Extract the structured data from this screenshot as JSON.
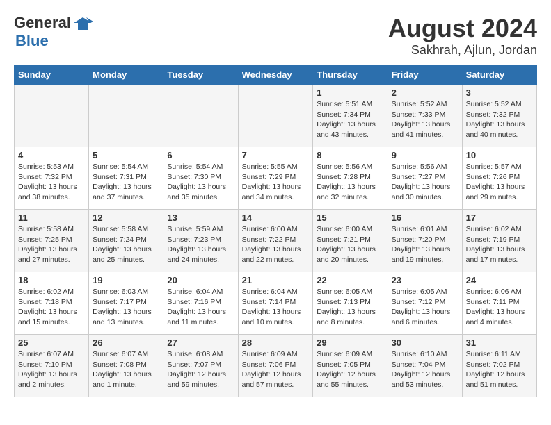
{
  "header": {
    "logo_general": "General",
    "logo_blue": "Blue",
    "title": "August 2024",
    "subtitle": "Sakhrah, Ajlun, Jordan"
  },
  "days_of_week": [
    "Sunday",
    "Monday",
    "Tuesday",
    "Wednesday",
    "Thursday",
    "Friday",
    "Saturday"
  ],
  "weeks": [
    {
      "cells": [
        {
          "day": "",
          "info": ""
        },
        {
          "day": "",
          "info": ""
        },
        {
          "day": "",
          "info": ""
        },
        {
          "day": "",
          "info": ""
        },
        {
          "day": "1",
          "info": "Sunrise: 5:51 AM\nSunset: 7:34 PM\nDaylight: 13 hours\nand 43 minutes."
        },
        {
          "day": "2",
          "info": "Sunrise: 5:52 AM\nSunset: 7:33 PM\nDaylight: 13 hours\nand 41 minutes."
        },
        {
          "day": "3",
          "info": "Sunrise: 5:52 AM\nSunset: 7:32 PM\nDaylight: 13 hours\nand 40 minutes."
        }
      ]
    },
    {
      "cells": [
        {
          "day": "4",
          "info": "Sunrise: 5:53 AM\nSunset: 7:32 PM\nDaylight: 13 hours\nand 38 minutes."
        },
        {
          "day": "5",
          "info": "Sunrise: 5:54 AM\nSunset: 7:31 PM\nDaylight: 13 hours\nand 37 minutes."
        },
        {
          "day": "6",
          "info": "Sunrise: 5:54 AM\nSunset: 7:30 PM\nDaylight: 13 hours\nand 35 minutes."
        },
        {
          "day": "7",
          "info": "Sunrise: 5:55 AM\nSunset: 7:29 PM\nDaylight: 13 hours\nand 34 minutes."
        },
        {
          "day": "8",
          "info": "Sunrise: 5:56 AM\nSunset: 7:28 PM\nDaylight: 13 hours\nand 32 minutes."
        },
        {
          "day": "9",
          "info": "Sunrise: 5:56 AM\nSunset: 7:27 PM\nDaylight: 13 hours\nand 30 minutes."
        },
        {
          "day": "10",
          "info": "Sunrise: 5:57 AM\nSunset: 7:26 PM\nDaylight: 13 hours\nand 29 minutes."
        }
      ]
    },
    {
      "cells": [
        {
          "day": "11",
          "info": "Sunrise: 5:58 AM\nSunset: 7:25 PM\nDaylight: 13 hours\nand 27 minutes."
        },
        {
          "day": "12",
          "info": "Sunrise: 5:58 AM\nSunset: 7:24 PM\nDaylight: 13 hours\nand 25 minutes."
        },
        {
          "day": "13",
          "info": "Sunrise: 5:59 AM\nSunset: 7:23 PM\nDaylight: 13 hours\nand 24 minutes."
        },
        {
          "day": "14",
          "info": "Sunrise: 6:00 AM\nSunset: 7:22 PM\nDaylight: 13 hours\nand 22 minutes."
        },
        {
          "day": "15",
          "info": "Sunrise: 6:00 AM\nSunset: 7:21 PM\nDaylight: 13 hours\nand 20 minutes."
        },
        {
          "day": "16",
          "info": "Sunrise: 6:01 AM\nSunset: 7:20 PM\nDaylight: 13 hours\nand 19 minutes."
        },
        {
          "day": "17",
          "info": "Sunrise: 6:02 AM\nSunset: 7:19 PM\nDaylight: 13 hours\nand 17 minutes."
        }
      ]
    },
    {
      "cells": [
        {
          "day": "18",
          "info": "Sunrise: 6:02 AM\nSunset: 7:18 PM\nDaylight: 13 hours\nand 15 minutes."
        },
        {
          "day": "19",
          "info": "Sunrise: 6:03 AM\nSunset: 7:17 PM\nDaylight: 13 hours\nand 13 minutes."
        },
        {
          "day": "20",
          "info": "Sunrise: 6:04 AM\nSunset: 7:16 PM\nDaylight: 13 hours\nand 11 minutes."
        },
        {
          "day": "21",
          "info": "Sunrise: 6:04 AM\nSunset: 7:14 PM\nDaylight: 13 hours\nand 10 minutes."
        },
        {
          "day": "22",
          "info": "Sunrise: 6:05 AM\nSunset: 7:13 PM\nDaylight: 13 hours\nand 8 minutes."
        },
        {
          "day": "23",
          "info": "Sunrise: 6:05 AM\nSunset: 7:12 PM\nDaylight: 13 hours\nand 6 minutes."
        },
        {
          "day": "24",
          "info": "Sunrise: 6:06 AM\nSunset: 7:11 PM\nDaylight: 13 hours\nand 4 minutes."
        }
      ]
    },
    {
      "cells": [
        {
          "day": "25",
          "info": "Sunrise: 6:07 AM\nSunset: 7:10 PM\nDaylight: 13 hours\nand 2 minutes."
        },
        {
          "day": "26",
          "info": "Sunrise: 6:07 AM\nSunset: 7:08 PM\nDaylight: 13 hours\nand 1 minute."
        },
        {
          "day": "27",
          "info": "Sunrise: 6:08 AM\nSunset: 7:07 PM\nDaylight: 12 hours\nand 59 minutes."
        },
        {
          "day": "28",
          "info": "Sunrise: 6:09 AM\nSunset: 7:06 PM\nDaylight: 12 hours\nand 57 minutes."
        },
        {
          "day": "29",
          "info": "Sunrise: 6:09 AM\nSunset: 7:05 PM\nDaylight: 12 hours\nand 55 minutes."
        },
        {
          "day": "30",
          "info": "Sunrise: 6:10 AM\nSunset: 7:04 PM\nDaylight: 12 hours\nand 53 minutes."
        },
        {
          "day": "31",
          "info": "Sunrise: 6:11 AM\nSunset: 7:02 PM\nDaylight: 12 hours\nand 51 minutes."
        }
      ]
    }
  ]
}
